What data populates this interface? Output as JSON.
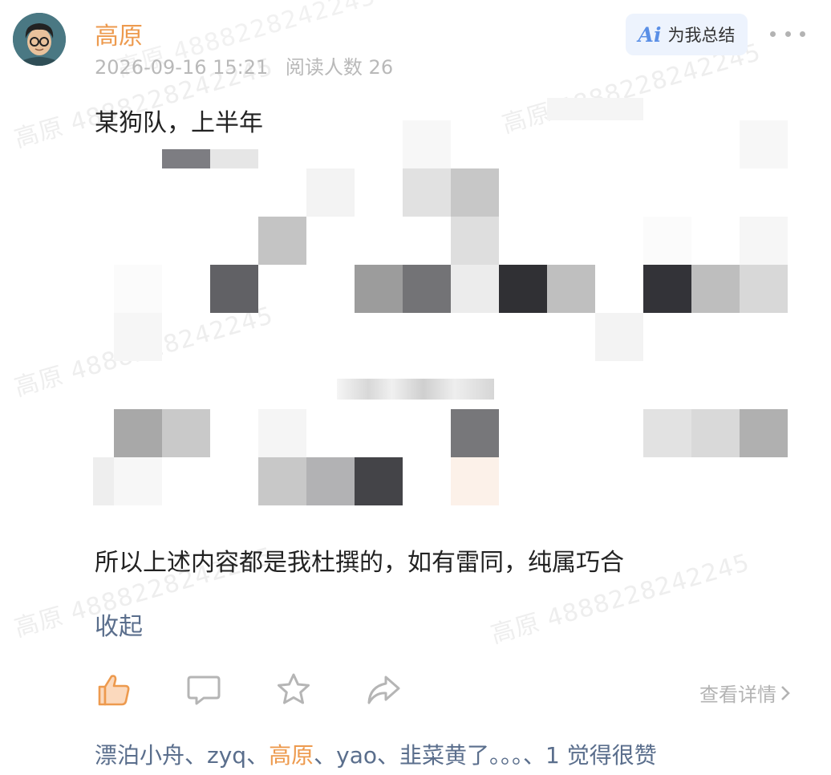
{
  "post": {
    "author": "高原",
    "time": "2026-09-16 15:21",
    "reads": "阅读人数 26",
    "ai_summary_label": "为我总结",
    "ai_mark": "Ai",
    "content_first_line": "某狗队，上半年",
    "content_last_line": "所以上述内容都是我杜撰的，如有雷同，纯属巧合",
    "collapse_label": "收起"
  },
  "watermark": "高原 4888228242245",
  "actions": {
    "like_icon": "thumb-up-icon",
    "comment_icon": "comment-icon",
    "favorite_icon": "star-icon",
    "share_icon": "share-icon",
    "detail_label": "查看详情"
  },
  "likes": {
    "names": [
      "漂泊小舟",
      "zyq",
      "高原",
      "yao",
      "韭菜黄了。。。"
    ],
    "separator": "、",
    "highlight_name": "高原",
    "suffix": "1 觉得很赞"
  },
  "colors": {
    "author": "#ed9a4e",
    "link": "#5a6e8c",
    "meta": "#b9b9b9",
    "ai_bg": "#edf3fd",
    "ai_accent": "#5a8fe6"
  }
}
